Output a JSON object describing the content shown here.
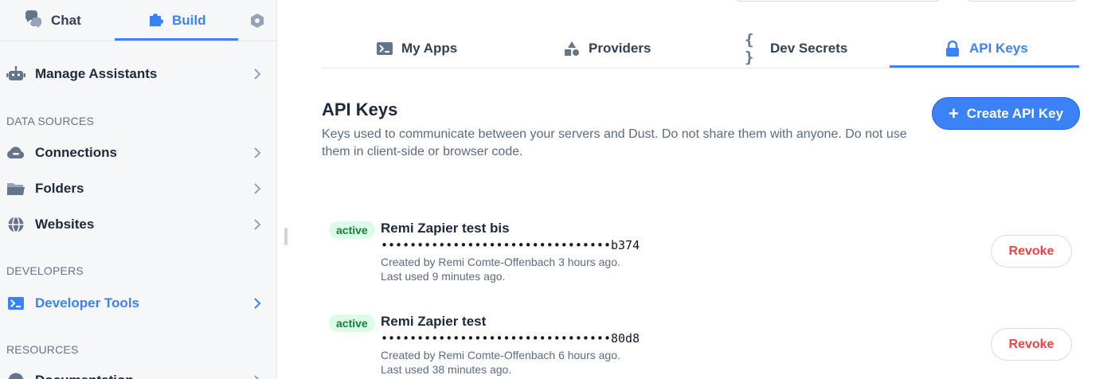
{
  "sidebar": {
    "tabs": {
      "chat": "Chat",
      "build": "Build"
    },
    "manage_assistants": "Manage Assistants",
    "sections": {
      "data_sources": "DATA SOURCES",
      "developers": "DEVELOPERS",
      "resources": "RESOURCES"
    },
    "data_sources_items": [
      {
        "label": "Connections"
      },
      {
        "label": "Folders"
      },
      {
        "label": "Websites"
      }
    ],
    "developer_tools": "Developer Tools",
    "resources_first_partial": "Documentation"
  },
  "main": {
    "tabs": [
      {
        "label": "My Apps",
        "icon": "terminal-icon"
      },
      {
        "label": "Providers",
        "icon": "shapes-icon"
      },
      {
        "label": "Dev Secrets",
        "icon": "braces-icon"
      },
      {
        "label": "API Keys",
        "icon": "lock-icon",
        "active": true
      }
    ],
    "title": "API Keys",
    "description": "Keys used to communicate between your servers and Dust. Do not share them with anyone. Do not use them in client-side or browser code.",
    "create_button": "Create API Key",
    "keys": [
      {
        "status": "active",
        "name": "Remi Zapier test bis",
        "secret": "••••••••••••••••••••••••••••••••b374",
        "created": "Created by Remi Comte-Offenbach 3 hours ago.",
        "last_used": "Last used 9 minutes ago.",
        "revoke_label": "Revoke"
      },
      {
        "status": "active",
        "name": "Remi Zapier test",
        "secret": "••••••••••••••••••••••••••••••••80d8",
        "created": "Created by Remi Comte-Offenbach 6 hours ago.",
        "last_used": "Last used 38 minutes ago.",
        "revoke_label": "Revoke"
      }
    ]
  },
  "colors": {
    "accent": "#3b82f6",
    "danger": "#ef4444",
    "badge_bg": "#dcfce7",
    "badge_text": "#15803d"
  }
}
